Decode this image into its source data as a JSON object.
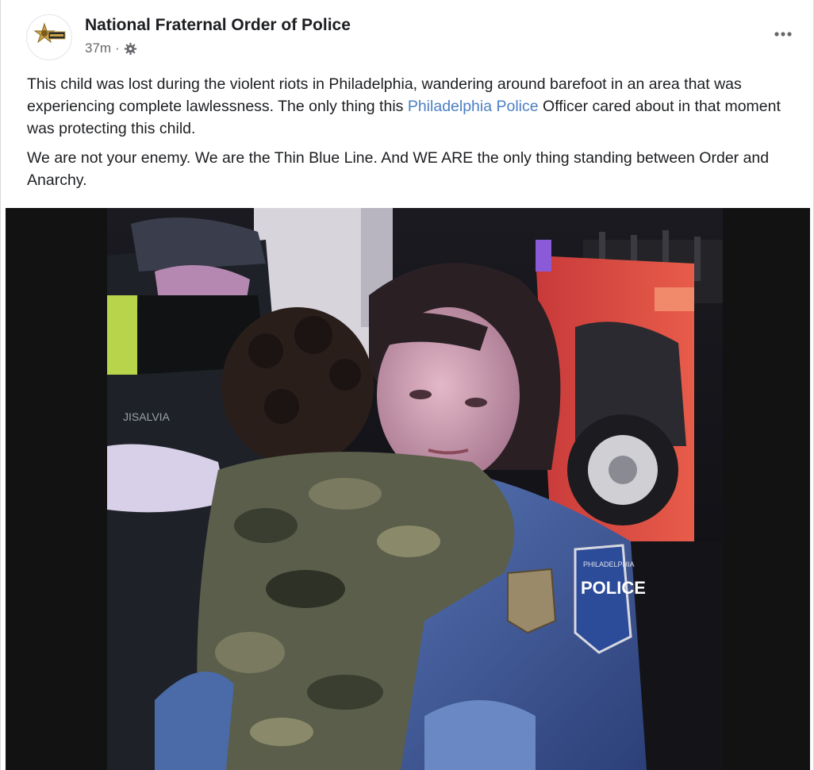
{
  "post": {
    "page_name": "National Fraternal Order of Police",
    "timestamp": "37m",
    "separator": "·",
    "audience_icon": "gear-icon",
    "more_icon": "ellipsis-icon",
    "paragraph1": {
      "before_link": "This child was lost during the violent riots in Philadelphia, wandering around barefoot in an area that was experiencing complete lawlessness. The only thing this ",
      "link": "Philadelphia Police",
      "after_link": " Officer cared about in that moment was protecting this child."
    },
    "paragraph2": "We are not your enemy. We are the Thin Blue Line. And WE ARE the only thing standing between Order and Anarchy."
  },
  "photo": {
    "name_tag": "JISALVIA",
    "patch_top": "PHILADELPHIA",
    "patch_main": "POLICE"
  },
  "colors": {
    "link": "#4b7fc4",
    "name": "#1c1e21",
    "meta": "#65676b"
  }
}
